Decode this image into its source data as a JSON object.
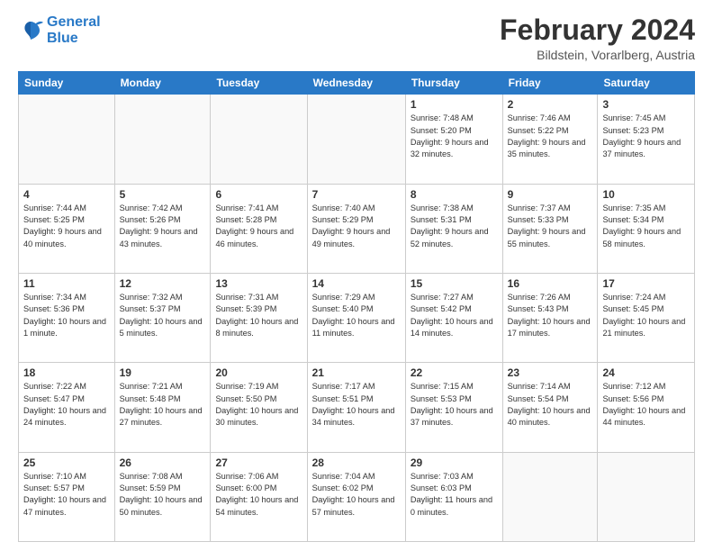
{
  "logo": {
    "line1": "General",
    "line2": "Blue"
  },
  "title": "February 2024",
  "subtitle": "Bildstein, Vorarlberg, Austria",
  "days_of_week": [
    "Sunday",
    "Monday",
    "Tuesday",
    "Wednesday",
    "Thursday",
    "Friday",
    "Saturday"
  ],
  "weeks": [
    [
      {
        "day": "",
        "info": ""
      },
      {
        "day": "",
        "info": ""
      },
      {
        "day": "",
        "info": ""
      },
      {
        "day": "",
        "info": ""
      },
      {
        "day": "1",
        "info": "Sunrise: 7:48 AM\nSunset: 5:20 PM\nDaylight: 9 hours\nand 32 minutes."
      },
      {
        "day": "2",
        "info": "Sunrise: 7:46 AM\nSunset: 5:22 PM\nDaylight: 9 hours\nand 35 minutes."
      },
      {
        "day": "3",
        "info": "Sunrise: 7:45 AM\nSunset: 5:23 PM\nDaylight: 9 hours\nand 37 minutes."
      }
    ],
    [
      {
        "day": "4",
        "info": "Sunrise: 7:44 AM\nSunset: 5:25 PM\nDaylight: 9 hours\nand 40 minutes."
      },
      {
        "day": "5",
        "info": "Sunrise: 7:42 AM\nSunset: 5:26 PM\nDaylight: 9 hours\nand 43 minutes."
      },
      {
        "day": "6",
        "info": "Sunrise: 7:41 AM\nSunset: 5:28 PM\nDaylight: 9 hours\nand 46 minutes."
      },
      {
        "day": "7",
        "info": "Sunrise: 7:40 AM\nSunset: 5:29 PM\nDaylight: 9 hours\nand 49 minutes."
      },
      {
        "day": "8",
        "info": "Sunrise: 7:38 AM\nSunset: 5:31 PM\nDaylight: 9 hours\nand 52 minutes."
      },
      {
        "day": "9",
        "info": "Sunrise: 7:37 AM\nSunset: 5:33 PM\nDaylight: 9 hours\nand 55 minutes."
      },
      {
        "day": "10",
        "info": "Sunrise: 7:35 AM\nSunset: 5:34 PM\nDaylight: 9 hours\nand 58 minutes."
      }
    ],
    [
      {
        "day": "11",
        "info": "Sunrise: 7:34 AM\nSunset: 5:36 PM\nDaylight: 10 hours\nand 1 minute."
      },
      {
        "day": "12",
        "info": "Sunrise: 7:32 AM\nSunset: 5:37 PM\nDaylight: 10 hours\nand 5 minutes."
      },
      {
        "day": "13",
        "info": "Sunrise: 7:31 AM\nSunset: 5:39 PM\nDaylight: 10 hours\nand 8 minutes."
      },
      {
        "day": "14",
        "info": "Sunrise: 7:29 AM\nSunset: 5:40 PM\nDaylight: 10 hours\nand 11 minutes."
      },
      {
        "day": "15",
        "info": "Sunrise: 7:27 AM\nSunset: 5:42 PM\nDaylight: 10 hours\nand 14 minutes."
      },
      {
        "day": "16",
        "info": "Sunrise: 7:26 AM\nSunset: 5:43 PM\nDaylight: 10 hours\nand 17 minutes."
      },
      {
        "day": "17",
        "info": "Sunrise: 7:24 AM\nSunset: 5:45 PM\nDaylight: 10 hours\nand 21 minutes."
      }
    ],
    [
      {
        "day": "18",
        "info": "Sunrise: 7:22 AM\nSunset: 5:47 PM\nDaylight: 10 hours\nand 24 minutes."
      },
      {
        "day": "19",
        "info": "Sunrise: 7:21 AM\nSunset: 5:48 PM\nDaylight: 10 hours\nand 27 minutes."
      },
      {
        "day": "20",
        "info": "Sunrise: 7:19 AM\nSunset: 5:50 PM\nDaylight: 10 hours\nand 30 minutes."
      },
      {
        "day": "21",
        "info": "Sunrise: 7:17 AM\nSunset: 5:51 PM\nDaylight: 10 hours\nand 34 minutes."
      },
      {
        "day": "22",
        "info": "Sunrise: 7:15 AM\nSunset: 5:53 PM\nDaylight: 10 hours\nand 37 minutes."
      },
      {
        "day": "23",
        "info": "Sunrise: 7:14 AM\nSunset: 5:54 PM\nDaylight: 10 hours\nand 40 minutes."
      },
      {
        "day": "24",
        "info": "Sunrise: 7:12 AM\nSunset: 5:56 PM\nDaylight: 10 hours\nand 44 minutes."
      }
    ],
    [
      {
        "day": "25",
        "info": "Sunrise: 7:10 AM\nSunset: 5:57 PM\nDaylight: 10 hours\nand 47 minutes."
      },
      {
        "day": "26",
        "info": "Sunrise: 7:08 AM\nSunset: 5:59 PM\nDaylight: 10 hours\nand 50 minutes."
      },
      {
        "day": "27",
        "info": "Sunrise: 7:06 AM\nSunset: 6:00 PM\nDaylight: 10 hours\nand 54 minutes."
      },
      {
        "day": "28",
        "info": "Sunrise: 7:04 AM\nSunset: 6:02 PM\nDaylight: 10 hours\nand 57 minutes."
      },
      {
        "day": "29",
        "info": "Sunrise: 7:03 AM\nSunset: 6:03 PM\nDaylight: 11 hours\nand 0 minutes."
      },
      {
        "day": "",
        "info": ""
      },
      {
        "day": "",
        "info": ""
      }
    ]
  ]
}
